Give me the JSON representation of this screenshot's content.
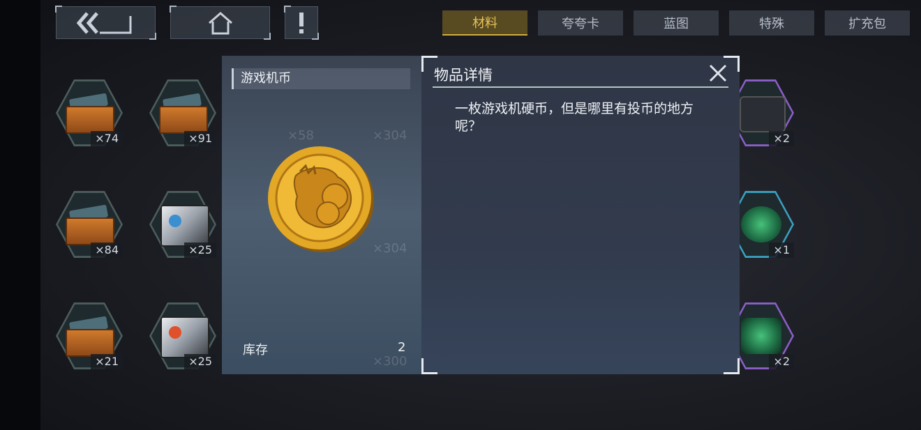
{
  "top_tabs": [
    {
      "label": "材料",
      "active": true
    },
    {
      "label": "夸夸卡",
      "active": false
    },
    {
      "label": "蓝图",
      "active": false
    },
    {
      "label": "特殊",
      "active": false
    },
    {
      "label": "扩充包",
      "active": false
    }
  ],
  "inventory": {
    "items": [
      {
        "count": "×74"
      },
      {
        "count": "×91"
      },
      {
        "count": "×2"
      },
      {
        "count": "×84"
      },
      {
        "count": "×25"
      },
      {
        "count": "×1"
      },
      {
        "count": "×21"
      },
      {
        "count": "×25"
      },
      {
        "count": "×2"
      }
    ],
    "ghost_counts": [
      "×58",
      "×304",
      "×304",
      "×300"
    ]
  },
  "item_panel": {
    "name": "游戏机币",
    "stock_label": "库存",
    "stock_value": "2"
  },
  "detail_panel": {
    "title": "物品详情",
    "description": "一枚游戏机硬币，但是哪里有投币的地方呢？"
  },
  "colors": {
    "accent_gold": "#e9c35a",
    "coin_gold": "#e3a826"
  }
}
